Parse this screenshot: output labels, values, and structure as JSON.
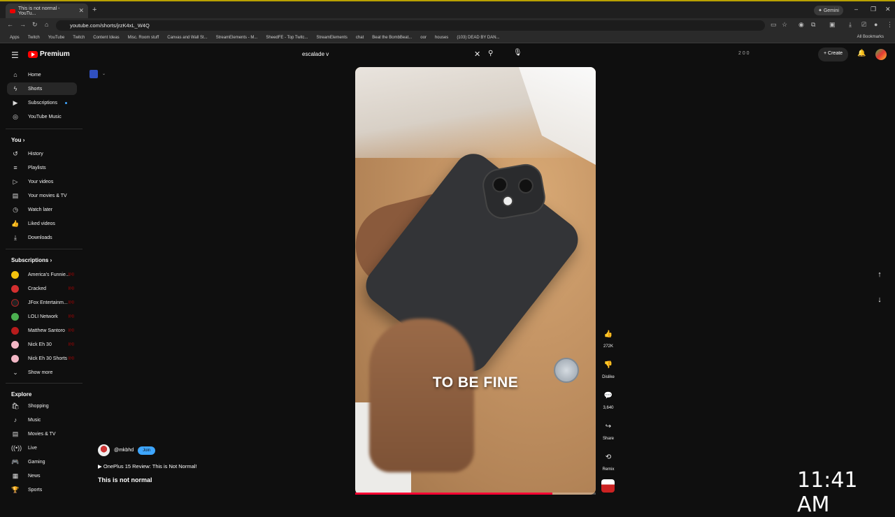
{
  "browser": {
    "tab_title": "This is not normal - YouTu...",
    "gemini_label": "Gemini",
    "url": "youtube.com/shorts/jrzK4xL_W4Q",
    "bookmarks": [
      "Apps",
      "Twitch",
      "YouTube",
      "Twitch",
      "Content Ideas",
      "Misc. Room stuff",
      "Canvas and Wall St...",
      "StreamElements - M...",
      "SheedFE - Top Twitc...",
      "StreamElements",
      "chat",
      "Beat the BombBeat...",
      "oor",
      "houses",
      "(103) DEAD BY DAN..."
    ],
    "all_bookmarks": "All Bookmarks"
  },
  "header": {
    "logo_text": "Premium",
    "search_value": "escalade v",
    "create_label": "Create",
    "ext_counts": "2  0  0"
  },
  "sidebar": {
    "main": [
      {
        "label": "Home",
        "icon": "home-icon"
      },
      {
        "label": "Shorts",
        "icon": "shorts-icon"
      },
      {
        "label": "Subscriptions",
        "icon": "subscriptions-icon"
      },
      {
        "label": "YouTube Music",
        "icon": "music-icon"
      }
    ],
    "you_heading": "You",
    "you": [
      {
        "label": "History",
        "icon": "history-icon"
      },
      {
        "label": "Playlists",
        "icon": "playlists-icon"
      },
      {
        "label": "Your videos",
        "icon": "your-videos-icon"
      },
      {
        "label": "Your movies & TV",
        "icon": "movies-icon"
      },
      {
        "label": "Watch later",
        "icon": "clock-icon"
      },
      {
        "label": "Liked videos",
        "icon": "like-icon"
      },
      {
        "label": "Downloads",
        "icon": "download-icon"
      }
    ],
    "subs_heading": "Subscriptions",
    "subs": [
      {
        "label": "America's Funnie...",
        "color": "#f4c20d"
      },
      {
        "label": "Cracked",
        "color": "#d32f2f"
      },
      {
        "label": "JFox Entertainm...",
        "color": "#222222"
      },
      {
        "label": "LOLI Network",
        "color": "#4caf50"
      },
      {
        "label": "Matthew Santoro",
        "color": "#b71c1c"
      },
      {
        "label": "Nick Eh 30",
        "color": "#f2b7c5"
      },
      {
        "label": "Nick Eh 30 Shorts",
        "color": "#f2b7c5"
      }
    ],
    "show_more": "Show more",
    "explore_heading": "Explore",
    "explore": [
      {
        "label": "Shopping",
        "icon": "shopping-icon"
      },
      {
        "label": "Music",
        "icon": "music-note-icon"
      },
      {
        "label": "Movies & TV",
        "icon": "film-icon"
      },
      {
        "label": "Live",
        "icon": "live-icon"
      },
      {
        "label": "Gaming",
        "icon": "gaming-icon"
      },
      {
        "label": "News",
        "icon": "news-icon"
      },
      {
        "label": "Sports",
        "icon": "trophy-icon"
      }
    ]
  },
  "short": {
    "caption": "TO BE FINE",
    "progress": 0.82,
    "likes": "272K",
    "dislike_label": "Dislike",
    "comments": "3,640",
    "share_label": "Share",
    "remix_label": "Remix",
    "channel": "@mkbhd",
    "join_label": "Join",
    "related_video": "OnePlus 15 Review: This is Not Normal!",
    "title": "This is not normal"
  },
  "overlay": {
    "clock": "11:41 AM"
  }
}
